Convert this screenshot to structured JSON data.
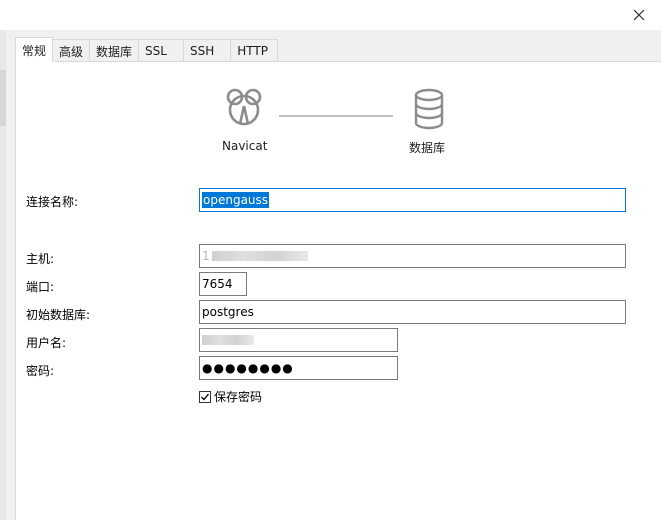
{
  "tabs": [
    {
      "label": "常规",
      "active": true
    },
    {
      "label": "高级",
      "active": false
    },
    {
      "label": "数据库",
      "active": false
    },
    {
      "label": "SSL",
      "active": false
    },
    {
      "label": "SSH",
      "active": false
    },
    {
      "label": "HTTP",
      "active": false
    }
  ],
  "graphic": {
    "left_label": "Navicat",
    "right_label": "数据库",
    "left_icon": "navicat-logo-icon",
    "right_icon": "database-icon"
  },
  "form": {
    "connection_name_label": "连接名称:",
    "connection_name_value": "opengauss",
    "host_label": "主机:",
    "host_value_prefix": "1",
    "port_label": "端口:",
    "port_value": "7654",
    "initial_db_label": "初始数据库:",
    "initial_db_value": "postgres",
    "username_label": "用户名:",
    "password_label": "密码:",
    "password_value": "●●●●●●●●",
    "save_password_label": "保存密码",
    "save_password_checked": true
  },
  "colors": {
    "selection": "#0078d7",
    "focus_border": "#0078d7",
    "field_border": "#7a7a7a"
  }
}
